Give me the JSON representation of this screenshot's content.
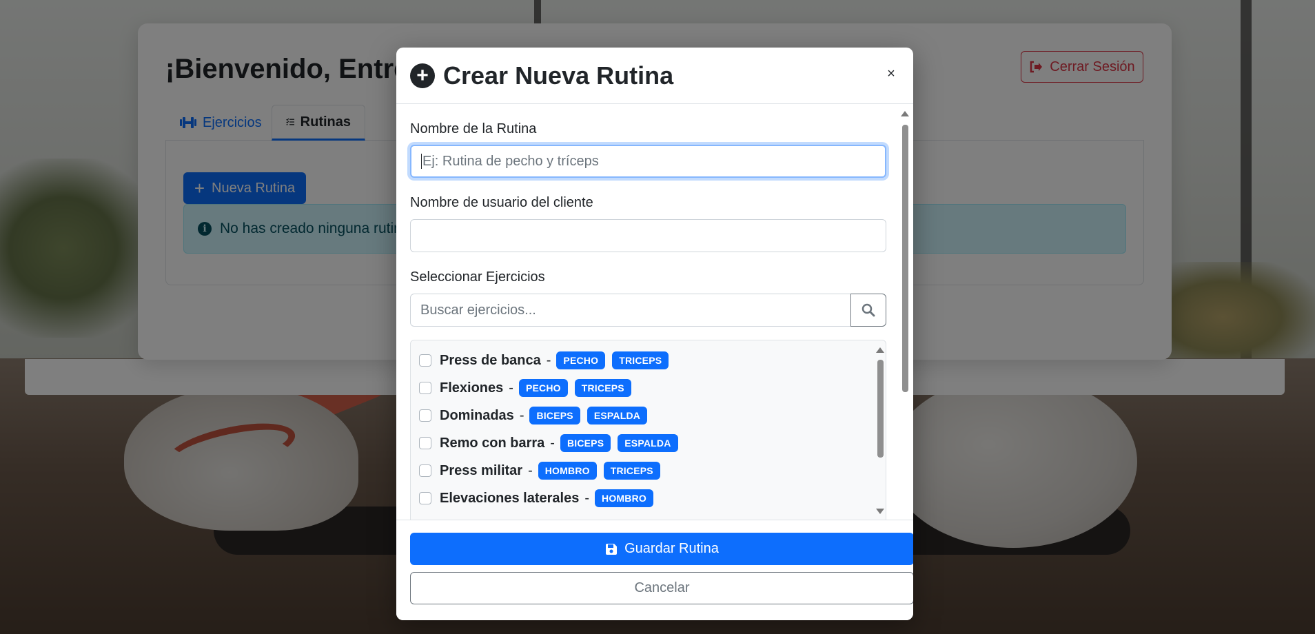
{
  "dashboard": {
    "welcome": "¡Bienvenido, Entrenador!",
    "logout_label": "Cerrar Sesión",
    "tabs": [
      {
        "label": "Ejercicios"
      },
      {
        "label": "Rutinas"
      }
    ],
    "new_routine_label": "Nueva Rutina",
    "empty_message": "No has creado ninguna rutina"
  },
  "modal": {
    "title": "Crear Nueva Rutina",
    "close_label": "×",
    "routine_name_label": "Nombre de la Rutina",
    "routine_name_placeholder": "Ej: Rutina de pecho y tríceps",
    "client_label": "Nombre de usuario del cliente",
    "client_value": "",
    "exercises_label": "Seleccionar Ejercicios",
    "search_placeholder": "Buscar ejercicios...",
    "exercises": [
      {
        "name": "Press de banca",
        "tags": [
          "PECHO",
          "TRICEPS"
        ]
      },
      {
        "name": "Flexiones",
        "tags": [
          "PECHO",
          "TRICEPS"
        ]
      },
      {
        "name": "Dominadas",
        "tags": [
          "BICEPS",
          "ESPALDA"
        ]
      },
      {
        "name": "Remo con barra",
        "tags": [
          "BICEPS",
          "ESPALDA"
        ]
      },
      {
        "name": "Press militar",
        "tags": [
          "HOMBRO",
          "TRICEPS"
        ]
      },
      {
        "name": "Elevaciones laterales",
        "tags": [
          "HOMBRO"
        ]
      }
    ],
    "save_label": "Guardar Rutina",
    "cancel_label": "Cancelar"
  },
  "colors": {
    "primary": "#0d6efd",
    "danger": "#dc3545",
    "info_bg": "#cff4fc"
  }
}
